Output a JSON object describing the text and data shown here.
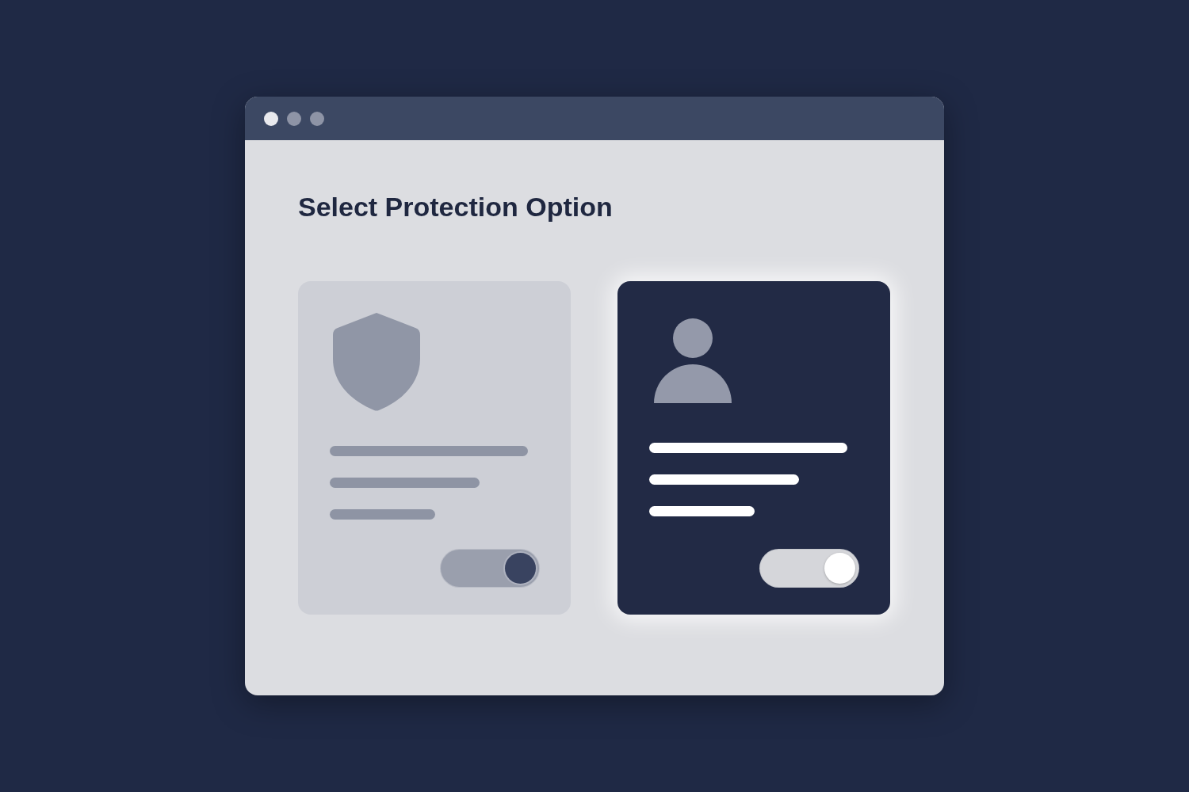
{
  "window": {
    "dots": [
      {
        "color": "#e9eaee"
      },
      {
        "color": "#8e94a6"
      },
      {
        "color": "#8e94a6"
      }
    ]
  },
  "heading": "Select Protection Option",
  "options": [
    {
      "kind": "shield",
      "selected": false,
      "toggle": {
        "on": true
      }
    },
    {
      "kind": "person",
      "selected": true,
      "toggle": {
        "on": true
      }
    }
  ]
}
